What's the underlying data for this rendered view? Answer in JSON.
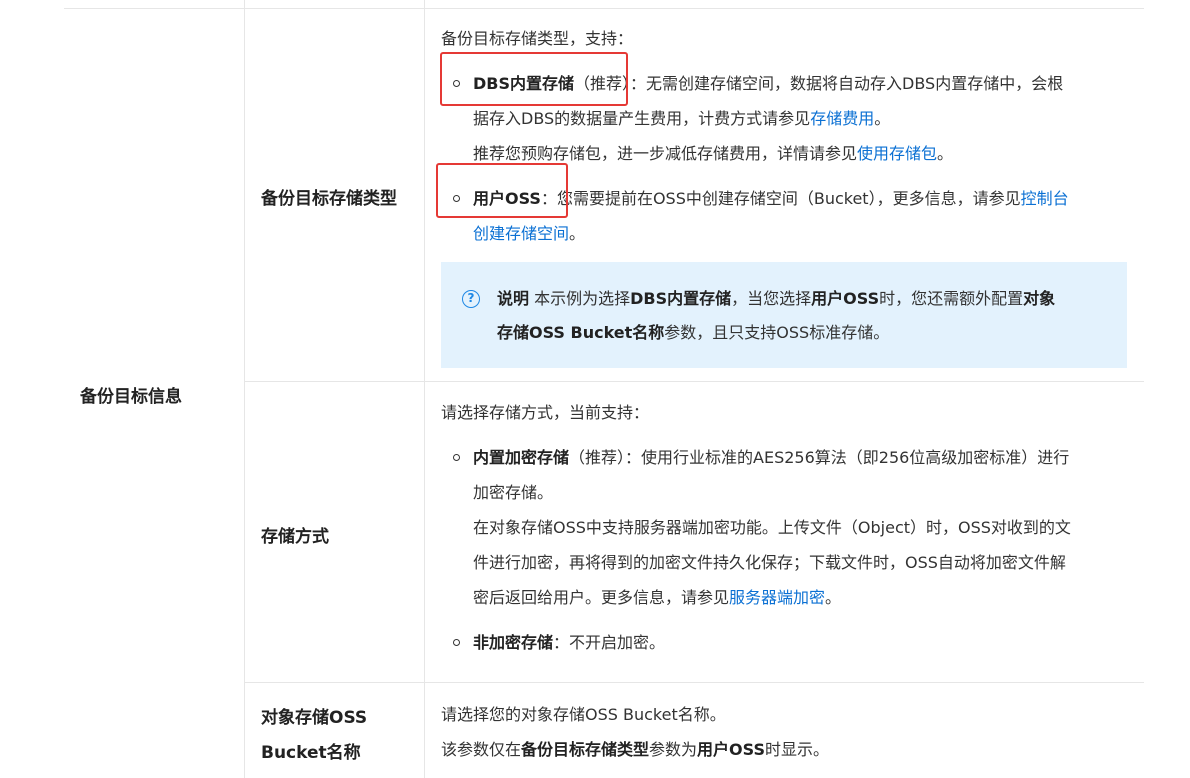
{
  "group_label": "备份目标信息",
  "rows": [
    {
      "label": "备份目标存储类型",
      "intro": "备份目标存储类型，支持：",
      "item1": {
        "bold": "DBS内置存储",
        "rec": "（推荐）：无需创建存储空间，数据将自动存入DBS内置存储中，会根",
        "line2_text": "据存入DBS的数据量产生费用，计费方式请参见",
        "line2_link": "存储费用",
        "line2_end": "。",
        "line3_text": "推荐您预购存储包，进一步减低存储费用，详情请参见",
        "line3_link": "使用存储包",
        "line3_end": "。"
      },
      "item2": {
        "bold": "用户OSS",
        "text": "：您需要提前在OSS中创建存储空间（Bucket），更多信息，请参见",
        "link1": "控制台",
        "link2": "创建存储空间",
        "end": "。"
      },
      "note": {
        "icon": "?",
        "title": "说明",
        "t1": "本示例为选择",
        "b1": "DBS内置存储",
        "t2": "，当您选择",
        "b2": "用户OSS",
        "t3": "时，您还需额外配置",
        "b3": "对象",
        "b4": "存储OSS Bucket名称",
        "t4": "参数，且只支持OSS标准存储。"
      }
    },
    {
      "label": "存储方式",
      "intro": "请选择存储方式，当前支持：",
      "item1": {
        "bold": "内置加密存储",
        "rec": "（推荐）：使用行业标准的AES256算法（即256位高级加密标准）进行",
        "line2": "加密存储。",
        "line3": "在对象存储OSS中支持服务器端加密功能。上传文件（Object）时，OSS对收到的文",
        "line4": "件进行加密，再将得到的加密文件持久化保存；下载文件时，OSS自动将加密文件解",
        "line5_text": "密后返回给用户。更多信息，请参见",
        "line5_link": "服务器端加密",
        "line5_end": "。"
      },
      "item2": {
        "bold": "非加密存储",
        "text": "：不开启加密。"
      }
    },
    {
      "label_line1": "对象存储OSS",
      "label_line2": "Bucket名称",
      "line1": "请选择您的对象存储OSS Bucket名称。",
      "line2_t1": "该参数仅在",
      "line2_b1": "备份目标存储类型",
      "line2_t2": "参数为",
      "line2_b2": "用户OSS",
      "line2_t3": "时显示。"
    }
  ],
  "colors": {
    "link": "#0b70d3",
    "note_bg": "#e3f2fd",
    "highlight_box": "#e53935",
    "icon": "#1e88e5"
  }
}
